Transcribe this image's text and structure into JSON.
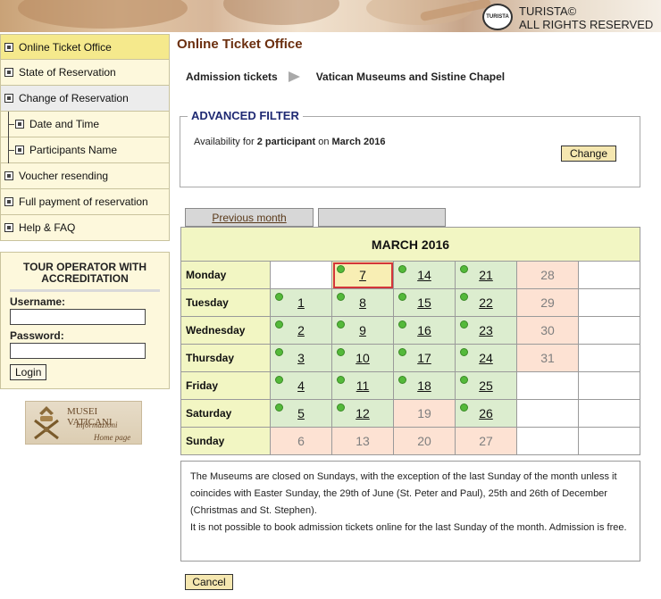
{
  "banner": {
    "logo_text": "TURISTA",
    "copyright_line1": "TURISTA©",
    "copyright_line2": "ALL RIGHTS RESERVED"
  },
  "sidebar": {
    "items": [
      {
        "label": "Online Ticket Office"
      },
      {
        "label": "State of Reservation"
      },
      {
        "label": "Change of Reservation"
      },
      {
        "label": "Date and Time"
      },
      {
        "label": "Participants Name"
      },
      {
        "label": "Voucher resending"
      },
      {
        "label": "Full payment of reservation"
      },
      {
        "label": "Help & FAQ"
      }
    ]
  },
  "operator": {
    "title": "TOUR OPERATOR WITH ACCREDITATION",
    "username_label": "Username:",
    "username_value": "",
    "password_label": "Password:",
    "password_value": "",
    "login_label": "Login"
  },
  "musei_logo": {
    "line1": "MUSEI VATICANI",
    "line2": "Informazioni",
    "line3": "Home page"
  },
  "main": {
    "title": "Online Ticket Office",
    "breadcrumb": {
      "first": "Admission tickets",
      "second": "Vatican Museums and Sistine Chapel"
    },
    "filter": {
      "legend": "ADVANCED FILTER",
      "text_prefix": "Availability for",
      "participants": "2 participant",
      "text_mid": "on",
      "month": "March 2016",
      "change_label": "Change"
    },
    "prev_month_label": "Previous month",
    "next_month_label": "",
    "calendar": {
      "header": "MARCH 2016",
      "days": [
        "Monday",
        "Tuesday",
        "Wednesday",
        "Thursday",
        "Friday",
        "Saturday",
        "Sunday"
      ],
      "rows": [
        [
          {
            "d": "",
            "s": "empty"
          },
          {
            "d": "7",
            "s": "sel"
          },
          {
            "d": "14",
            "s": "av"
          },
          {
            "d": "21",
            "s": "av"
          },
          {
            "d": "28",
            "s": "cl"
          },
          {
            "d": "",
            "s": "empty"
          }
        ],
        [
          {
            "d": "1",
            "s": "av"
          },
          {
            "d": "8",
            "s": "av"
          },
          {
            "d": "15",
            "s": "av"
          },
          {
            "d": "22",
            "s": "av"
          },
          {
            "d": "29",
            "s": "cl"
          },
          {
            "d": "",
            "s": "empty"
          }
        ],
        [
          {
            "d": "2",
            "s": "av"
          },
          {
            "d": "9",
            "s": "av"
          },
          {
            "d": "16",
            "s": "av"
          },
          {
            "d": "23",
            "s": "av"
          },
          {
            "d": "30",
            "s": "cl"
          },
          {
            "d": "",
            "s": "empty"
          }
        ],
        [
          {
            "d": "3",
            "s": "av"
          },
          {
            "d": "10",
            "s": "av"
          },
          {
            "d": "17",
            "s": "av"
          },
          {
            "d": "24",
            "s": "av"
          },
          {
            "d": "31",
            "s": "cl"
          },
          {
            "d": "",
            "s": "empty"
          }
        ],
        [
          {
            "d": "4",
            "s": "av"
          },
          {
            "d": "11",
            "s": "av"
          },
          {
            "d": "18",
            "s": "av"
          },
          {
            "d": "25",
            "s": "av"
          },
          {
            "d": "",
            "s": "empty"
          },
          {
            "d": "",
            "s": "empty"
          }
        ],
        [
          {
            "d": "5",
            "s": "av"
          },
          {
            "d": "12",
            "s": "av"
          },
          {
            "d": "19",
            "s": "cl"
          },
          {
            "d": "26",
            "s": "av"
          },
          {
            "d": "",
            "s": "empty"
          },
          {
            "d": "",
            "s": "empty"
          }
        ],
        [
          {
            "d": "6",
            "s": "cl"
          },
          {
            "d": "13",
            "s": "cl"
          },
          {
            "d": "20",
            "s": "cl"
          },
          {
            "d": "27",
            "s": "cl"
          },
          {
            "d": "",
            "s": "empty"
          },
          {
            "d": "",
            "s": "empty"
          }
        ]
      ]
    },
    "notice": {
      "para1": "The Museums are closed on Sundays, with the exception of the last Sunday of the month unless it coincides with Easter Sunday, the 29th of June (St. Peter and Paul), 25th and 26th of December (Christmas and St. Stephen).",
      "para2": "It is not possible to book admission tickets online for the last Sunday of the month. Admission is free."
    },
    "cancel_label": "Cancel"
  },
  "colors": {
    "title_brown": "#6b2f0f",
    "legend_navy": "#1f2a73",
    "available_green": "#dcedcf",
    "closed_salmon": "#fde2d3",
    "selected_yellow": "#f8eeb4",
    "selection_red": "#d3353a",
    "dot_green": "#54b93a",
    "sidebar_bg": "#fdf8dc",
    "sidebar_active": "#f5e98c"
  }
}
